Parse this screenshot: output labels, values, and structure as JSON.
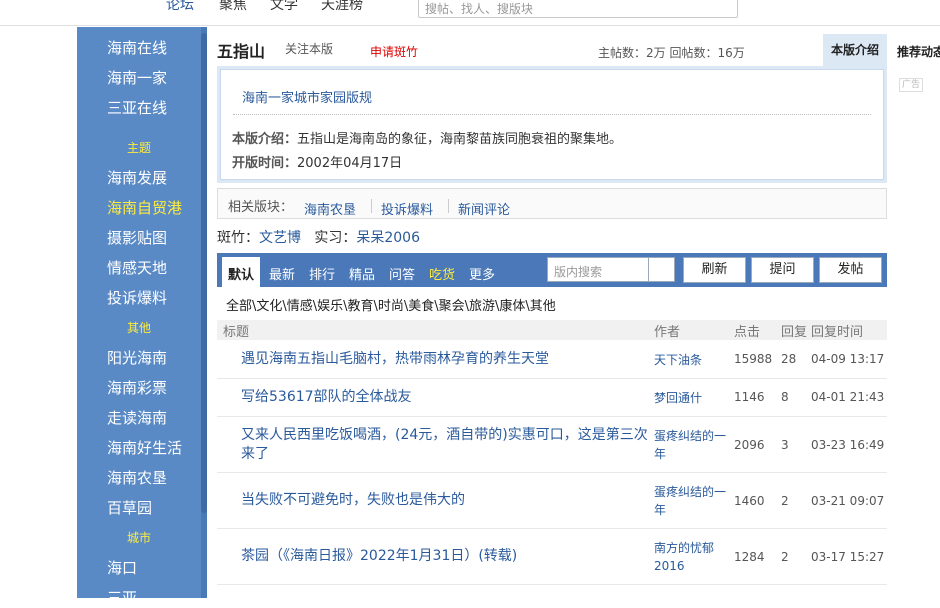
{
  "topnav": {
    "items": [
      "论坛",
      "聚焦",
      "文学",
      "天涯榜"
    ],
    "search_placeholder": "搜帖、找人、搜版块"
  },
  "sidebar": {
    "group1": [
      "海南在线",
      "海南一家",
      "三亚在线"
    ],
    "head_theme": "主题",
    "group2": [
      "海南发展",
      "海南自贸港",
      "摄影贴图",
      "情感天地",
      "投诉爆料"
    ],
    "head_other": "其他",
    "group3": [
      "阳光海南",
      "海南彩票",
      "走读海南",
      "海南好生活",
      "海南农垦",
      "百草园"
    ],
    "head_city": "城市",
    "group4": [
      "海口",
      "三亚"
    ]
  },
  "board": {
    "title": "五指山",
    "follow": "关注本版",
    "apply": "申请斑竹",
    "stats": "主帖数：2万 回帖数：16万",
    "tab_intro": "本版介绍",
    "tab_rec": "推荐动态",
    "ad": "广告",
    "rules_link": "海南一家城市家园版规",
    "intro_label": "本版介绍：",
    "intro_text": "五指山是海南岛的象征，海南黎苗族同胞衰祖的聚集地。",
    "date_label": "开版时间：",
    "date_text": "2002年04月17日"
  },
  "related": {
    "label": "相关版块：",
    "links": [
      "海南农垦",
      "投诉爆料",
      "新闻评论"
    ]
  },
  "moderators": {
    "label1": "斑竹：",
    "mod1": "文艺博",
    "label2": "实习：",
    "mod2": "呆呆2006"
  },
  "toolbar": {
    "tabs": [
      "默认",
      "最新",
      "排行",
      "精品",
      "问答",
      "吃货",
      "更多"
    ],
    "search_placeholder": "版内搜索",
    "refresh": "刷新",
    "ask": "提问",
    "post": "发帖"
  },
  "categories": "全部\\文化\\情感\\娱乐\\教育\\时尚\\美食\\聚会\\旅游\\康体\\其他",
  "table": {
    "headers": {
      "title": "标题",
      "author": "作者",
      "clicks": "点击",
      "replies": "回复",
      "time": "回复时间"
    },
    "rows": [
      {
        "title": "遇见海南五指山毛脑村，热带雨林孕育的养生天堂",
        "author": "天下油条",
        "clicks": "15988",
        "replies": "28",
        "time": "04-09 13:17"
      },
      {
        "title": "写给53617部队的全体战友",
        "author": "梦回通什",
        "clicks": "1146",
        "replies": "8",
        "time": "04-01 21:43"
      },
      {
        "title": "又来人民西里吃饭喝酒，(24元，酒自带的)实惠可口，这是第三次来了",
        "author": "蛋疼纠结的一年",
        "clicks": "2096",
        "replies": "3",
        "time": "03-23 16:49"
      },
      {
        "title": "当失败不可避免时，失败也是伟大的",
        "author": "蛋疼纠结的一年",
        "clicks": "1460",
        "replies": "2",
        "time": "03-21 09:07"
      },
      {
        "title": "茶园（《海南日报》2022年1月31日）(转载)",
        "author": "南方的忧郁2016",
        "clicks": "1284",
        "replies": "2",
        "time": "03-17 15:27"
      }
    ]
  }
}
